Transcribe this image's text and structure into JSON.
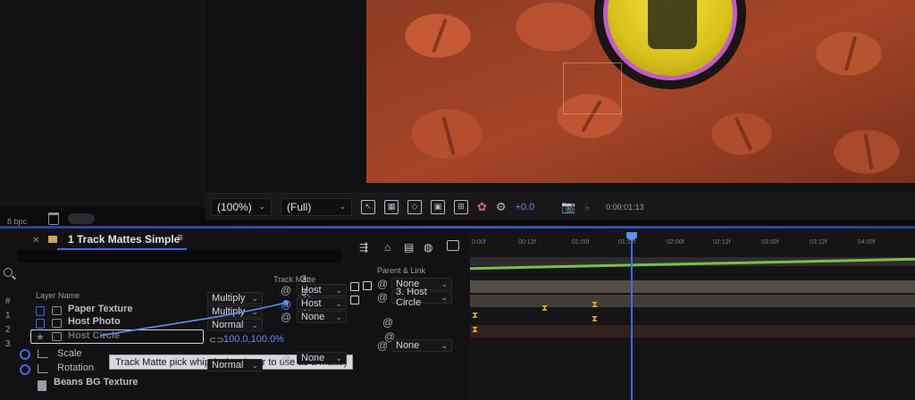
{
  "viewer": {
    "zoom": "(100%)",
    "resolution": "(Full)",
    "exposure": "+0.0",
    "timecode": "0:00:01:13"
  },
  "project": {
    "bpc": "8 bpc"
  },
  "timeline": {
    "tab_title": "1 Track Mattes Simple",
    "tab_menu": "≡",
    "columns": {
      "layer_name": "Layer Name",
      "track_matte": "Track Matte",
      "parent_link": "Parent & Link"
    },
    "ruler": [
      "0:00f",
      "00:12f",
      "01:00f",
      "01:12f",
      "02:00f",
      "02:12f",
      "03:00f",
      "03:12f",
      "04:00f"
    ],
    "layers": [
      {
        "index": "",
        "name": "Paper Texture",
        "mode": "Multiply",
        "matte": "3. Host Ci",
        "parent": "None"
      },
      {
        "index": "1",
        "name": "Host Photo",
        "mode": "Multiply",
        "matte": "3. Host Ci",
        "parent": "3. Host Circle"
      },
      {
        "index": "2",
        "name": "Host Circle",
        "mode": "Normal",
        "matte": "None",
        "parent": "None"
      },
      {
        "index": "3",
        "name": "",
        "mode": "",
        "matte": "",
        "parent": ""
      }
    ],
    "props": {
      "scale_label": "Scale",
      "scale_value": "100.0,100.0%",
      "rotation_label": "Rotation",
      "beans_layer": "Beans BG Texture",
      "beans_mode": "Normal",
      "beans_matte": "None",
      "beans_parent": "None"
    },
    "tooltip": "Track Matte pick whip (select layer to use as a matte)"
  },
  "colors": {
    "accent": "#3f6bea",
    "keyframe": "#e0a62a",
    "work_bar": "#7bc043"
  }
}
